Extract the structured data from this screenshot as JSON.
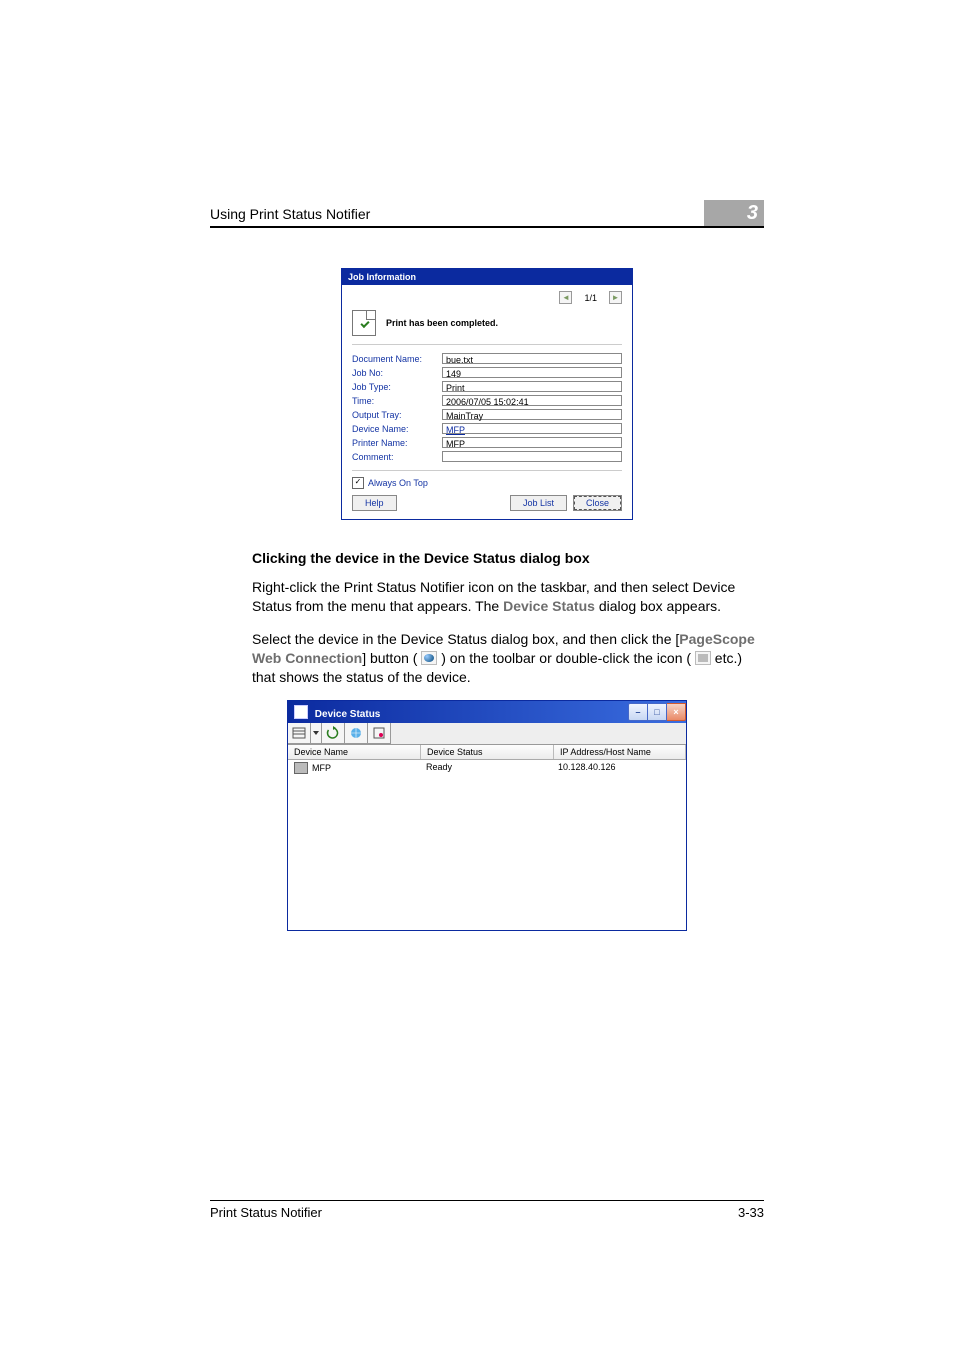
{
  "header": {
    "running_title": "Using Print Status Notifier",
    "chapter_number": "3"
  },
  "job_info": {
    "title": "Job Information",
    "page_indicator": "1/1",
    "status_message": "Print has been completed.",
    "rows": [
      {
        "label": "Document Name:",
        "value": "bue.txt"
      },
      {
        "label": "Job No:",
        "value": "149"
      },
      {
        "label": "Job Type:",
        "value": "Print"
      },
      {
        "label": "Time:",
        "value": "2006/07/05 15:02:41"
      },
      {
        "label": "Output Tray:",
        "value": "MainTray"
      },
      {
        "label": "Device Name:",
        "value": "MFP",
        "is_link": true
      },
      {
        "label": "Printer Name:",
        "value": "MFP"
      },
      {
        "label": "Comment:",
        "value": ""
      }
    ],
    "always_on_top_label": "Always On Top",
    "always_on_top_checked": true,
    "buttons": {
      "help": "Help",
      "job_list": "Job List",
      "close": "Close"
    }
  },
  "section_heading": "Clicking the device in the Device Status dialog box",
  "para1_pre": "Right-click the Print Status Notifier icon on the taskbar, and then select Device Status from the menu that appears. The ",
  "para1_link": "Device Status",
  "para1_post": " dialog box appears.",
  "para2_pre": "Select the device in the Device Status dialog box, and then click the [",
  "para2_link": "PageScope Web Connection",
  "para2_post1": "] button ( ",
  "para2_post2": " ) on the toolbar or double-click the icon ( ",
  "para2_post3": " etc.) that shows the status of the device.",
  "device_status": {
    "title": "Device Status",
    "columns": [
      "Device Name",
      "Device Status",
      "IP Address/Host Name"
    ],
    "rows": [
      {
        "name": "MFP",
        "status": "Ready",
        "ip": "10.128.40.126"
      }
    ]
  },
  "footer": {
    "doc_title": "Print Status Notifier",
    "page_number": "3-33"
  }
}
